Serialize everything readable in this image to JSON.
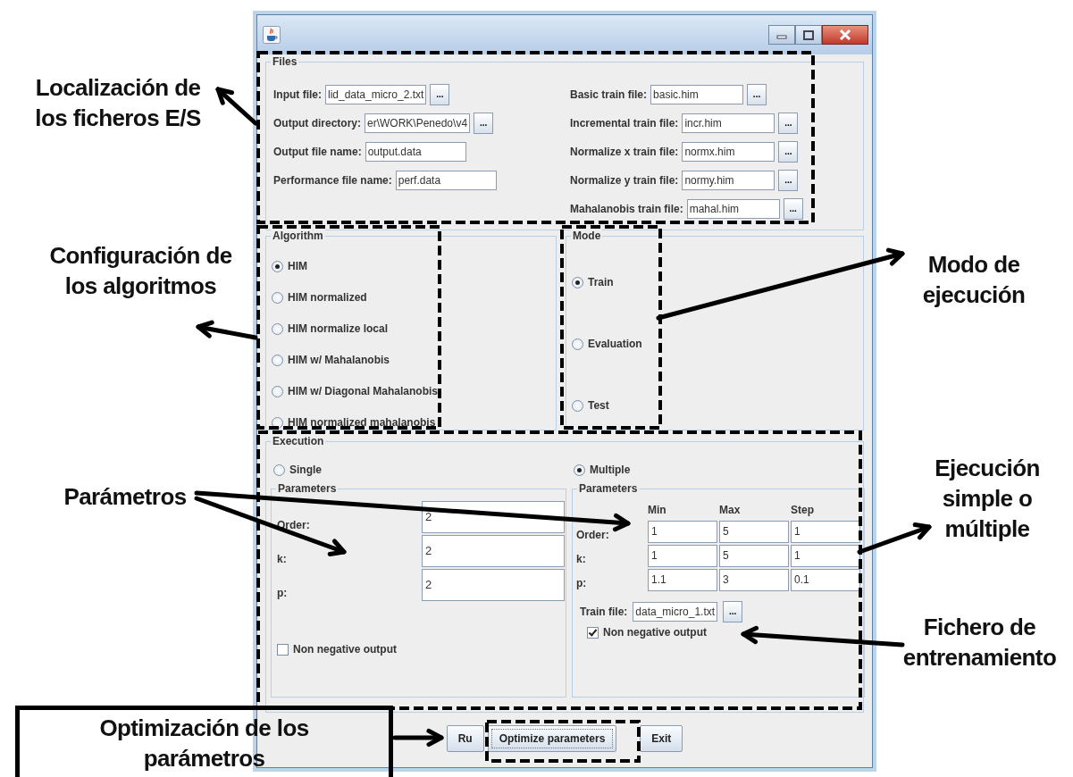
{
  "files": {
    "title": "Files",
    "left": [
      {
        "label": "Input file:",
        "value": "lid_data_micro_2.txt",
        "browse": "..."
      },
      {
        "label": "Output directory:",
        "value": "er\\WORK\\Penedo\\v4",
        "browse": "..."
      },
      {
        "label": "Output file name:",
        "value": "output.data"
      },
      {
        "label": "Performance file name:",
        "value": "perf.data"
      }
    ],
    "right": [
      {
        "label": "Basic train file:",
        "value": "basic.him",
        "browse": "..."
      },
      {
        "label": "Incremental train file:",
        "value": "incr.him",
        "browse": "..."
      },
      {
        "label": "Normalize x train file:",
        "value": "normx.him",
        "browse": "..."
      },
      {
        "label": "Normalize y train file:",
        "value": "normy.him",
        "browse": "..."
      },
      {
        "label": "Mahalanobis train file:",
        "value": "mahal.him",
        "browse": "..."
      }
    ]
  },
  "algorithm": {
    "title": "Algorithm",
    "options": [
      {
        "label": "HIM",
        "selected": true
      },
      {
        "label": "HIM normalized",
        "selected": false
      },
      {
        "label": "HIM normalize local",
        "selected": false
      },
      {
        "label": "HIM w/ Mahalanobis",
        "selected": false
      },
      {
        "label": "HIM w/ Diagonal Mahalanobis",
        "selected": false
      },
      {
        "label": "HIM normalized mahalanobis",
        "selected": false
      }
    ]
  },
  "mode": {
    "title": "Mode",
    "options": [
      {
        "label": "Train",
        "selected": true
      },
      {
        "label": "Evaluation",
        "selected": false
      },
      {
        "label": "Test",
        "selected": false
      }
    ]
  },
  "execution": {
    "title": "Execution",
    "choices": [
      {
        "label": "Single",
        "selected": false
      },
      {
        "label": "Multiple",
        "selected": true
      }
    ],
    "single": {
      "title": "Parameters",
      "rows": [
        {
          "label": "Order:",
          "value": "2"
        },
        {
          "label": "k:",
          "value": "2"
        },
        {
          "label": "p:",
          "value": "2"
        }
      ],
      "non_negative": {
        "label": "Non negative output",
        "checked": false
      }
    },
    "multiple": {
      "title": "Parameters",
      "columns": [
        "Min",
        "Max",
        "Step"
      ],
      "rows": [
        {
          "label": "Order:",
          "values": [
            "1",
            "5",
            "1"
          ]
        },
        {
          "label": "k:",
          "values": [
            "1",
            "5",
            "1"
          ]
        },
        {
          "label": "p:",
          "values": [
            "1.1",
            "3",
            "0.1"
          ]
        }
      ],
      "train_file": {
        "label": "Train file:",
        "value": "data_micro_1.txt",
        "browse": "..."
      },
      "non_negative": {
        "label": "Non negative output",
        "checked": true
      }
    }
  },
  "buttons": [
    {
      "label": "Ru"
    },
    {
      "label": "Optimize parameters"
    },
    {
      "label": "Exit"
    }
  ],
  "annotations": [
    {
      "text": "Localización de\nlos ficheros E/S"
    },
    {
      "text": "Configuración de\nlos algoritmos"
    },
    {
      "text": "Modo de\nejecución"
    },
    {
      "text": "Parámetros"
    },
    {
      "text": "Ejecución\nsimple o\nmúltiple"
    },
    {
      "text": "Fichero de\nentrenamiento"
    },
    {
      "text": "Optimización de los\nparámetros"
    }
  ]
}
